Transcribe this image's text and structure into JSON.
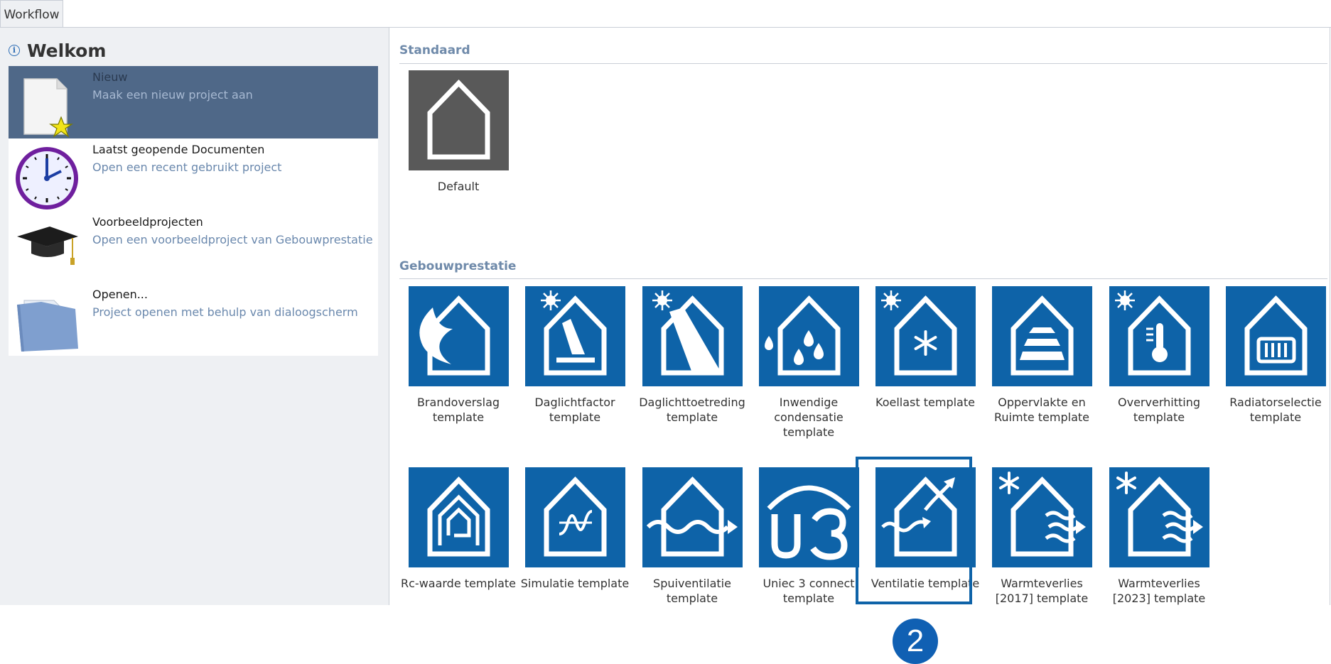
{
  "tabs": [
    {
      "label": "Workflow"
    }
  ],
  "welcome": {
    "title": "Welkom",
    "info_icon": "info-icon"
  },
  "workflow_items": [
    {
      "title": "Nieuw",
      "subtitle": "Maak een nieuw project aan",
      "icon": "new-document-icon",
      "selected": true
    },
    {
      "title": "Laatst geopende Documenten",
      "subtitle": "Open een recent gebruikt project",
      "icon": "clock-icon",
      "selected": false
    },
    {
      "title": "Voorbeeldprojecten",
      "subtitle": "Open een voorbeeldproject van Gebouwprestatie",
      "icon": "graduation-cap-icon",
      "selected": false
    },
    {
      "title": "Openen...",
      "subtitle": "Project openen met behulp van dialoogscherm",
      "icon": "folder-icon",
      "selected": false
    }
  ],
  "sections": {
    "standaard": {
      "title": "Standaard",
      "templates": [
        {
          "label": "Default",
          "icon": "house-icon"
        }
      ]
    },
    "gebouwprestatie": {
      "title": "Gebouwprestatie",
      "templates": [
        {
          "label": "Brandoverslag template",
          "icon": "fire-house-icon"
        },
        {
          "label": "Daglichtfactor template",
          "icon": "daylight-factor-icon"
        },
        {
          "label": "Daglichttoetreding template",
          "icon": "daylight-entry-icon"
        },
        {
          "label": "Inwendige condensatie template",
          "icon": "condensation-icon"
        },
        {
          "label": "Koellast template",
          "icon": "cooling-load-icon"
        },
        {
          "label": "Oppervlakte en Ruimte template",
          "icon": "area-room-icon"
        },
        {
          "label": "Oververhitting template",
          "icon": "overheating-icon"
        },
        {
          "label": "Radiatorselectie template",
          "icon": "radiator-icon"
        },
        {
          "label": "Rc-waarde template",
          "icon": "rc-value-icon"
        },
        {
          "label": "Simulatie template",
          "icon": "simulation-icon"
        },
        {
          "label": "Spuiventilatie template",
          "icon": "purge-ventilation-icon"
        },
        {
          "label": "Uniec 3 connect template",
          "icon": "uniec3-icon"
        },
        {
          "label": "Ventilatie template",
          "icon": "ventilation-icon"
        },
        {
          "label": "Warmteverlies [2017] template",
          "icon": "heat-loss-2017-icon"
        },
        {
          "label": "Warmteverlies [2023] template",
          "icon": "heat-loss-2023-icon"
        }
      ]
    }
  },
  "callout": {
    "label": "2"
  },
  "colors": {
    "tile_blue": "#0e63a8",
    "tile_gray": "#595959",
    "selected_row": "#4f6888",
    "section_title": "#6f8aaa"
  }
}
